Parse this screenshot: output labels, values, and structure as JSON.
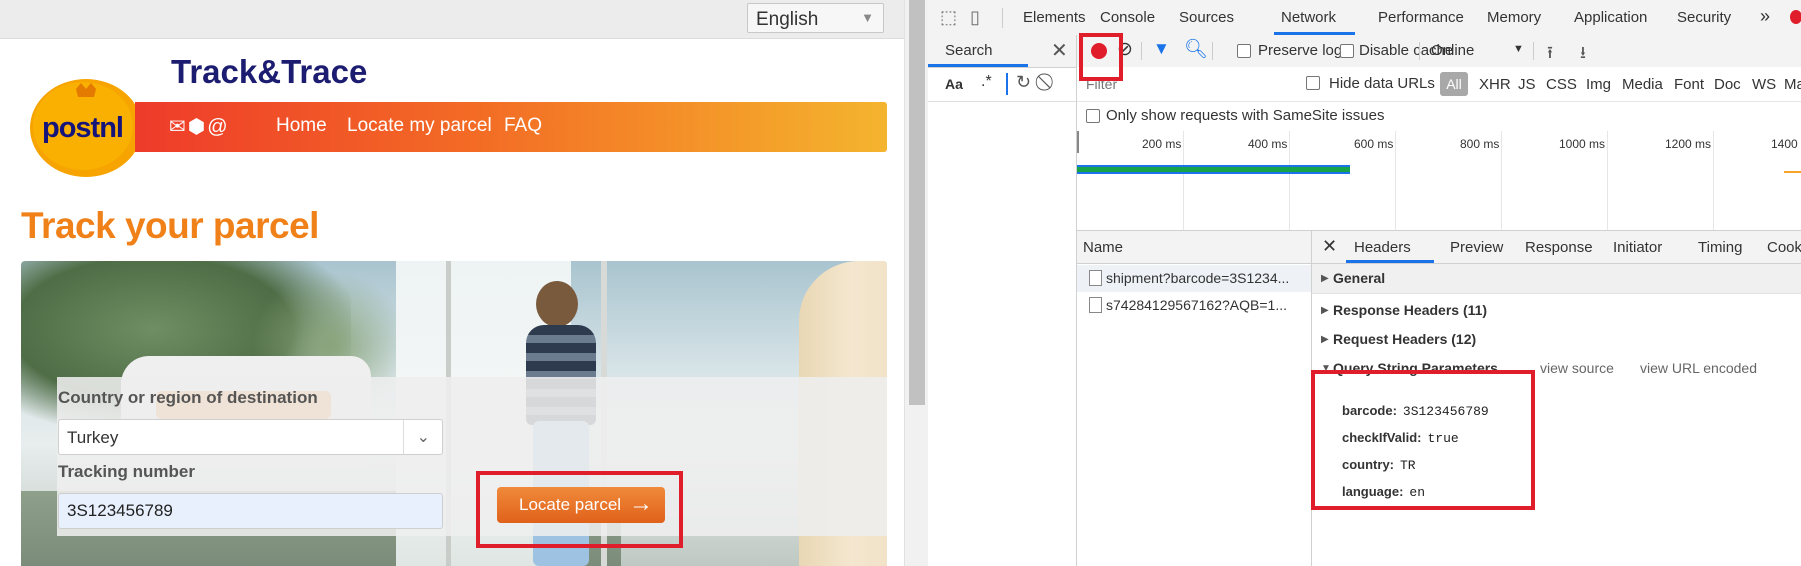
{
  "page": {
    "language_selected": "English",
    "logo_text": "postnl",
    "site_title": "Track&Trace",
    "nav": {
      "home": "Home",
      "locate": "Locate my parcel",
      "faq": "FAQ"
    },
    "heading": "Track your parcel",
    "form": {
      "country_label": "Country or region of destination",
      "country_value": "Turkey",
      "tracking_label": "Tracking number",
      "tracking_value": "3S123456789",
      "locate_button": "Locate parcel"
    }
  },
  "devtools": {
    "tabs": [
      "Elements",
      "Console",
      "Sources",
      "Network",
      "Performance",
      "Memory",
      "Application",
      "Security"
    ],
    "more_tabs": "»",
    "active_tab": "Network",
    "search": {
      "title": "Search",
      "match_case": "Aa",
      "regex": ".*"
    },
    "toolbar": {
      "preserve_log": "Preserve log",
      "disable_cache": "Disable cache",
      "throttling": "Online"
    },
    "filter": {
      "placeholder": "Filter",
      "hide_data_urls": "Hide data URLs",
      "all": "All",
      "types": [
        "XHR",
        "JS",
        "CSS",
        "Img",
        "Media",
        "Font",
        "Doc",
        "WS",
        "Ma"
      ]
    },
    "samesite_label": "Only show requests with SameSite issues",
    "timeline_ticks": [
      "200 ms",
      "400 ms",
      "600 ms",
      "800 ms",
      "1000 ms",
      "1200 ms",
      "1400"
    ],
    "requests": {
      "name_column": "Name",
      "rows": [
        "shipment?barcode=3S1234...",
        "s74284129567162?AQB=1..."
      ]
    },
    "detail": {
      "tabs": [
        "Headers",
        "Preview",
        "Response",
        "Initiator",
        "Timing",
        "Cookies"
      ],
      "sections": {
        "general": "General",
        "response_headers": "Response Headers (11)",
        "request_headers": "Request Headers (12)",
        "query": "Query String Parameters"
      },
      "view_source": "view source",
      "view_url_encoded": "view URL encoded",
      "params": [
        {
          "key": "barcode:",
          "value": "3S123456789"
        },
        {
          "key": "checkIfValid:",
          "value": "true"
        },
        {
          "key": "country:",
          "value": "TR"
        },
        {
          "key": "language:",
          "value": "en"
        }
      ]
    }
  },
  "colors": {
    "highlight": "#e01d2a",
    "accent": "#1a73e8",
    "brand_orange": "#f08018"
  }
}
